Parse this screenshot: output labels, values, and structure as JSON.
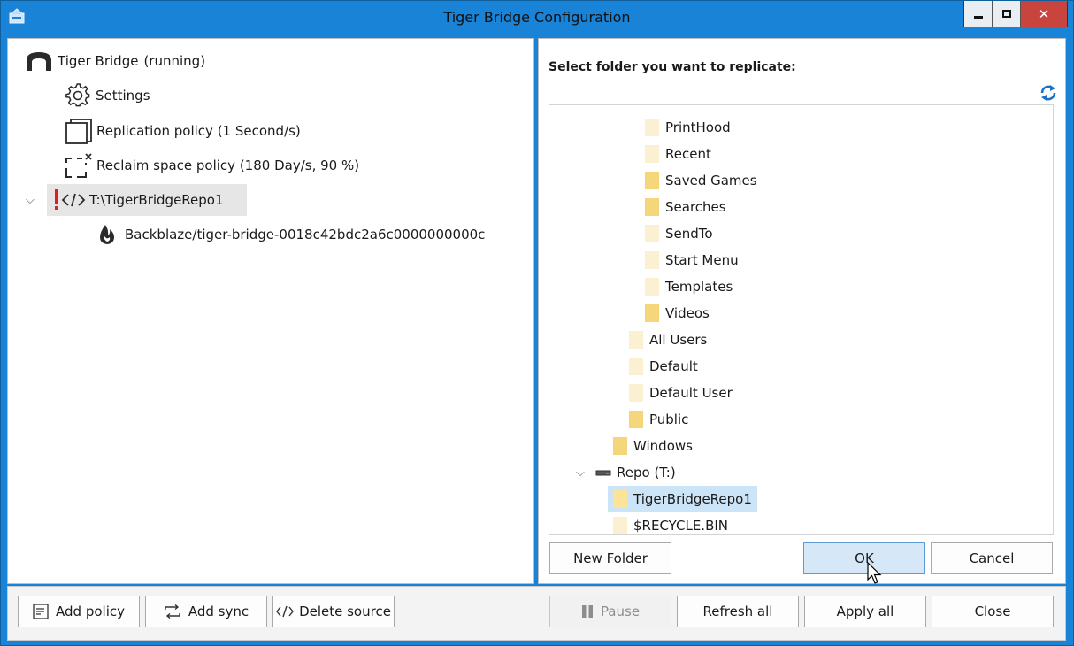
{
  "window": {
    "title": "Tiger Bridge Configuration"
  },
  "left_tree": {
    "root_label": "Tiger Bridge",
    "root_status": "(running)",
    "settings": "Settings",
    "replication_policy": "Replication policy (1 Second/s)",
    "reclaim_policy": "Reclaim space policy (180 Day/s, 90 %)",
    "source": "T:\\TigerBridgeRepo1",
    "target": "Backblaze/tiger-bridge-0018c42bdc2a6c0000000000c"
  },
  "right_panel": {
    "title": "Select folder you want to replicate:",
    "folders": [
      "PrintHood",
      "Recent",
      "Saved Games",
      "Searches",
      "SendTo",
      "Start Menu",
      "Templates",
      "Videos",
      "All Users",
      "Default",
      "Default User",
      "Public",
      "Windows",
      "Repo (T:)",
      "TigerBridgeRepo1",
      "$RECYCLE.BIN"
    ],
    "new_folder": "New Folder",
    "ok": "OK",
    "cancel": "Cancel"
  },
  "bottom": {
    "add_policy": "Add policy",
    "add_sync": "Add sync",
    "delete_source": "Delete source",
    "pause": "Pause",
    "refresh_all": "Refresh all",
    "apply_all": "Apply all",
    "close": "Close"
  },
  "colors": {
    "accent": "#1883d7",
    "running": "#3a8fd6",
    "selection": "#cce4f7",
    "warning": "#e02020",
    "folder": "#f5d67b"
  }
}
